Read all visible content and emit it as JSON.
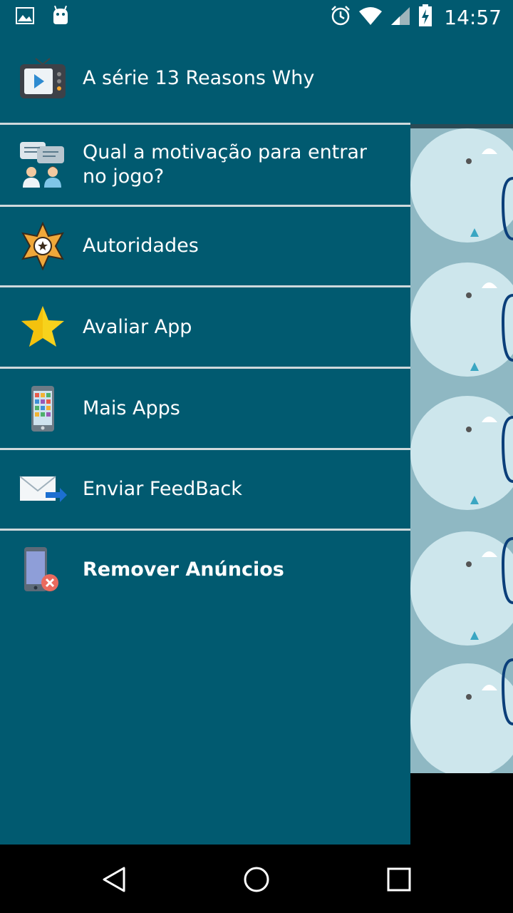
{
  "status_bar": {
    "time": "14:57",
    "icons": [
      "image-icon",
      "android-icon",
      "alarm-icon",
      "wifi-icon",
      "signal-icon",
      "battery-charging-icon"
    ]
  },
  "drawer": {
    "items": [
      {
        "label": "A série 13 Reasons Why",
        "icon": "tv-play-icon"
      },
      {
        "label": "Qual a motivação para entrar no jogo?",
        "icon": "chat-people-icon"
      },
      {
        "label": "Autoridades",
        "icon": "sheriff-star-icon"
      },
      {
        "label": "Avaliar App",
        "icon": "star-icon"
      },
      {
        "label": "Mais Apps",
        "icon": "phone-apps-icon"
      },
      {
        "label": "Enviar FeedBack",
        "icon": "mail-send-icon"
      },
      {
        "label": "Remover Anúncios",
        "icon": "phone-remove-icon"
      }
    ]
  },
  "nav_bar": {
    "buttons": [
      "back",
      "home",
      "recents"
    ]
  },
  "colors": {
    "drawer": "#015a70",
    "divider": "#cfd9dc",
    "pattern": "#8fb8c3"
  }
}
